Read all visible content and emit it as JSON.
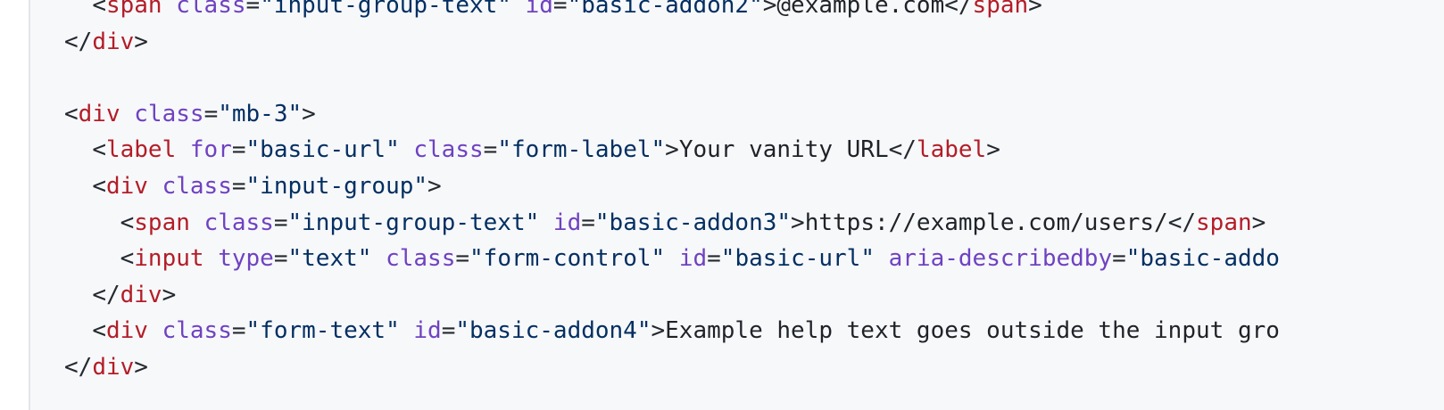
{
  "colors": {
    "background": "#f7f8fa",
    "tag": "#b31d28",
    "attribute": "#6f42c1",
    "string": "#032f62",
    "text": "#1f2328"
  },
  "code_lines": [
    {
      "indent": "  ",
      "tokens": [
        {
          "type": "punct",
          "text": "<"
        },
        {
          "type": "tag",
          "text": "span"
        },
        {
          "type": "text",
          "text": " "
        },
        {
          "type": "attr",
          "text": "class"
        },
        {
          "type": "punct",
          "text": "="
        },
        {
          "type": "str",
          "text": "\"input-group-text\""
        },
        {
          "type": "text",
          "text": " "
        },
        {
          "type": "attr",
          "text": "id"
        },
        {
          "type": "punct",
          "text": "="
        },
        {
          "type": "str",
          "text": "\"basic-addon2\""
        },
        {
          "type": "punct",
          "text": ">"
        },
        {
          "type": "text",
          "text": "@example.com"
        },
        {
          "type": "punct",
          "text": "</"
        },
        {
          "type": "tag",
          "text": "span"
        },
        {
          "type": "punct",
          "text": ">"
        }
      ]
    },
    {
      "indent": "",
      "tokens": [
        {
          "type": "punct",
          "text": "</"
        },
        {
          "type": "tag",
          "text": "div"
        },
        {
          "type": "punct",
          "text": ">"
        }
      ]
    },
    {
      "indent": "",
      "tokens": []
    },
    {
      "indent": "",
      "tokens": [
        {
          "type": "punct",
          "text": "<"
        },
        {
          "type": "tag",
          "text": "div"
        },
        {
          "type": "text",
          "text": " "
        },
        {
          "type": "attr",
          "text": "class"
        },
        {
          "type": "punct",
          "text": "="
        },
        {
          "type": "str",
          "text": "\"mb-3\""
        },
        {
          "type": "punct",
          "text": ">"
        }
      ]
    },
    {
      "indent": "  ",
      "tokens": [
        {
          "type": "punct",
          "text": "<"
        },
        {
          "type": "tag",
          "text": "label"
        },
        {
          "type": "text",
          "text": " "
        },
        {
          "type": "attr",
          "text": "for"
        },
        {
          "type": "punct",
          "text": "="
        },
        {
          "type": "str",
          "text": "\"basic-url\""
        },
        {
          "type": "text",
          "text": " "
        },
        {
          "type": "attr",
          "text": "class"
        },
        {
          "type": "punct",
          "text": "="
        },
        {
          "type": "str",
          "text": "\"form-label\""
        },
        {
          "type": "punct",
          "text": ">"
        },
        {
          "type": "text",
          "text": "Your vanity URL"
        },
        {
          "type": "punct",
          "text": "</"
        },
        {
          "type": "tag",
          "text": "label"
        },
        {
          "type": "punct",
          "text": ">"
        }
      ]
    },
    {
      "indent": "  ",
      "tokens": [
        {
          "type": "punct",
          "text": "<"
        },
        {
          "type": "tag",
          "text": "div"
        },
        {
          "type": "text",
          "text": " "
        },
        {
          "type": "attr",
          "text": "class"
        },
        {
          "type": "punct",
          "text": "="
        },
        {
          "type": "str",
          "text": "\"input-group\""
        },
        {
          "type": "punct",
          "text": ">"
        }
      ]
    },
    {
      "indent": "    ",
      "tokens": [
        {
          "type": "punct",
          "text": "<"
        },
        {
          "type": "tag",
          "text": "span"
        },
        {
          "type": "text",
          "text": " "
        },
        {
          "type": "attr",
          "text": "class"
        },
        {
          "type": "punct",
          "text": "="
        },
        {
          "type": "str",
          "text": "\"input-group-text\""
        },
        {
          "type": "text",
          "text": " "
        },
        {
          "type": "attr",
          "text": "id"
        },
        {
          "type": "punct",
          "text": "="
        },
        {
          "type": "str",
          "text": "\"basic-addon3\""
        },
        {
          "type": "punct",
          "text": ">"
        },
        {
          "type": "text",
          "text": "https://example.com/users/"
        },
        {
          "type": "punct",
          "text": "</"
        },
        {
          "type": "tag",
          "text": "span"
        },
        {
          "type": "punct",
          "text": ">"
        }
      ]
    },
    {
      "indent": "    ",
      "tokens": [
        {
          "type": "punct",
          "text": "<"
        },
        {
          "type": "tag",
          "text": "input"
        },
        {
          "type": "text",
          "text": " "
        },
        {
          "type": "attr",
          "text": "type"
        },
        {
          "type": "punct",
          "text": "="
        },
        {
          "type": "str",
          "text": "\"text\""
        },
        {
          "type": "text",
          "text": " "
        },
        {
          "type": "attr",
          "text": "class"
        },
        {
          "type": "punct",
          "text": "="
        },
        {
          "type": "str",
          "text": "\"form-control\""
        },
        {
          "type": "text",
          "text": " "
        },
        {
          "type": "attr",
          "text": "id"
        },
        {
          "type": "punct",
          "text": "="
        },
        {
          "type": "str",
          "text": "\"basic-url\""
        },
        {
          "type": "text",
          "text": " "
        },
        {
          "type": "attr",
          "text": "aria-describedby"
        },
        {
          "type": "punct",
          "text": "="
        },
        {
          "type": "str",
          "text": "\"basic-addo"
        }
      ]
    },
    {
      "indent": "  ",
      "tokens": [
        {
          "type": "punct",
          "text": "</"
        },
        {
          "type": "tag",
          "text": "div"
        },
        {
          "type": "punct",
          "text": ">"
        }
      ]
    },
    {
      "indent": "  ",
      "tokens": [
        {
          "type": "punct",
          "text": "<"
        },
        {
          "type": "tag",
          "text": "div"
        },
        {
          "type": "text",
          "text": " "
        },
        {
          "type": "attr",
          "text": "class"
        },
        {
          "type": "punct",
          "text": "="
        },
        {
          "type": "str",
          "text": "\"form-text\""
        },
        {
          "type": "text",
          "text": " "
        },
        {
          "type": "attr",
          "text": "id"
        },
        {
          "type": "punct",
          "text": "="
        },
        {
          "type": "str",
          "text": "\"basic-addon4\""
        },
        {
          "type": "punct",
          "text": ">"
        },
        {
          "type": "text",
          "text": "Example help text goes outside the input gro"
        }
      ]
    },
    {
      "indent": "",
      "tokens": [
        {
          "type": "punct",
          "text": "</"
        },
        {
          "type": "tag",
          "text": "div"
        },
        {
          "type": "punct",
          "text": ">"
        }
      ]
    }
  ]
}
